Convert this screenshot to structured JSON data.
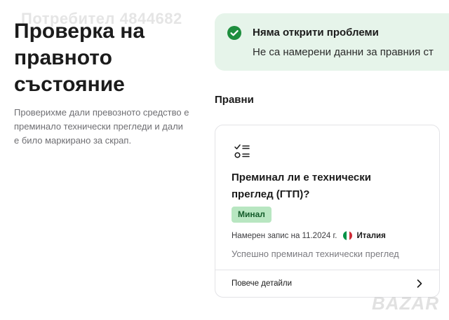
{
  "watermark": {
    "top_text": "Потребител 4844682",
    "logo_text": "BAZAR"
  },
  "header": {
    "title": "Проверка на правното състояние",
    "description": "Проверихме дали превозното средство е преминало технически прегледи и дали е било маркирано за скрап."
  },
  "status": {
    "icon": "check-circle-icon",
    "color": "#1e8e3e",
    "title": "Няма открити проблеми",
    "text": "Не са намерени данни за правния ст"
  },
  "section": {
    "title": "Правни"
  },
  "card": {
    "icon": "checklist-icon",
    "title": "Преминал ли е технически преглед (ГТП)?",
    "badge": "Минал",
    "badge_color": "#b8e6c1",
    "record_prefix": "Намерен запис на 11.2024 г.",
    "country": "Италия",
    "flag_colors": [
      "#009246",
      "#ffffff",
      "#ce2b37"
    ],
    "result": "Успешно преминал технически преглед",
    "details_label": "Повече детайли",
    "details_icon": "chevron-right-icon"
  }
}
